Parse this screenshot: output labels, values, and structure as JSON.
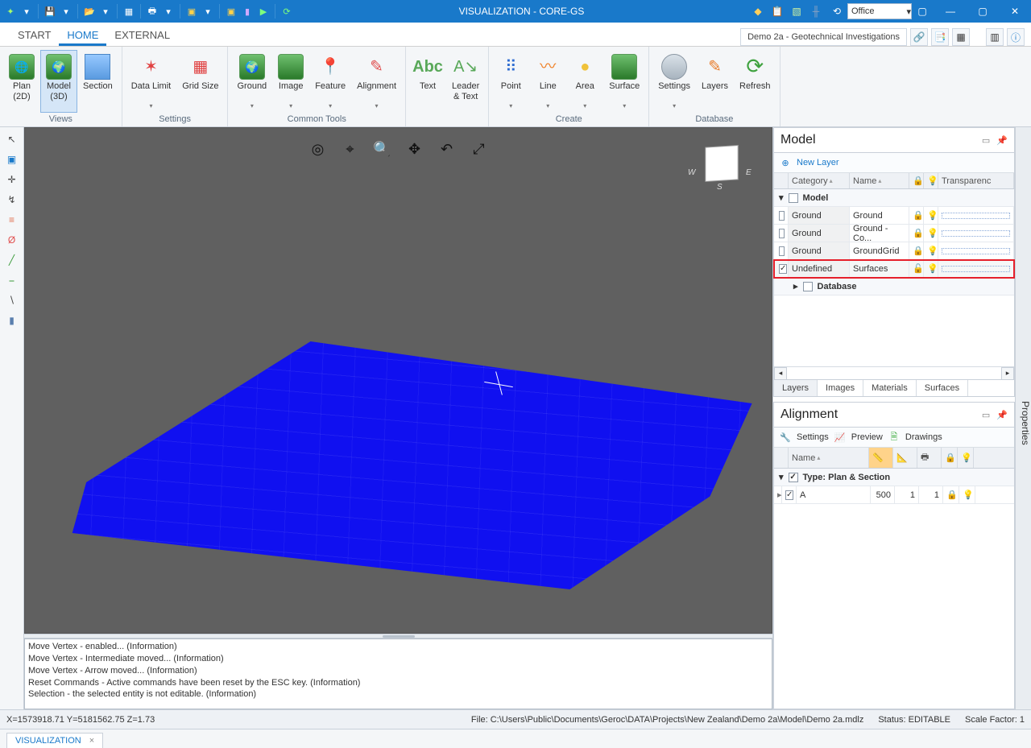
{
  "titlebar": {
    "title": "VISUALIZATION - CORE-GS",
    "office_dropdown": "Office"
  },
  "menubar": {
    "tabs": [
      "START",
      "HOME",
      "EXTERNAL"
    ],
    "active": 1,
    "project_name": "Demo 2a - Geotechnical Investigations"
  },
  "ribbon": {
    "groups": [
      {
        "label": "Views",
        "items": [
          {
            "t": "Plan",
            "t2": "(2D)"
          },
          {
            "t": "Model",
            "t2": "(3D)",
            "sel": true
          },
          {
            "t": "Section"
          }
        ]
      },
      {
        "label": "Settings",
        "items": [
          {
            "t": "Data Limit",
            "dd": true
          },
          {
            "t": "Grid Size"
          }
        ]
      },
      {
        "label": "Common Tools",
        "items": [
          {
            "t": "Ground",
            "dd": true
          },
          {
            "t": "Image",
            "dd": true
          },
          {
            "t": "Feature",
            "dd": true
          },
          {
            "t": "Alignment",
            "dd": true
          }
        ]
      },
      {
        "label": "",
        "items": [
          {
            "t": "Text"
          },
          {
            "t": "Leader",
            "t2": "& Text"
          }
        ]
      },
      {
        "label": "Create",
        "items": [
          {
            "t": "Point",
            "dd": true
          },
          {
            "t": "Line",
            "dd": true
          },
          {
            "t": "Area",
            "dd": true
          },
          {
            "t": "Surface",
            "dd": true
          }
        ]
      },
      {
        "label": "Database",
        "items": [
          {
            "t": "Settings",
            "dd": true
          },
          {
            "t": "Layers"
          },
          {
            "t": "Refresh"
          }
        ]
      }
    ]
  },
  "model_panel": {
    "title": "Model",
    "new_layer": "New Layer",
    "headers": {
      "category": "Category",
      "name": "Name",
      "transparency": "Transparenc"
    },
    "tree_root": "Model",
    "rows": [
      {
        "cat": "Ground",
        "name": "Ground",
        "checked": false
      },
      {
        "cat": "Ground",
        "name": "Ground - Co...",
        "checked": false
      },
      {
        "cat": "Ground",
        "name": "GroundGrid",
        "checked": false
      },
      {
        "cat": "Undefined",
        "name": "Surfaces",
        "checked": true,
        "hl": true
      }
    ],
    "db_node": "Database",
    "tabs": [
      "Layers",
      "Images",
      "Materials",
      "Surfaces"
    ]
  },
  "alignment_panel": {
    "title": "Alignment",
    "toolbar": {
      "settings": "Settings",
      "preview": "Preview",
      "drawings": "Drawings"
    },
    "header_name": "Name",
    "tree": "Type: Plan & Section",
    "row": {
      "name": "A",
      "v1": "500",
      "v2": "1",
      "v3": "1"
    }
  },
  "properties_tab": "Properties",
  "log_messages": [
    "Move Vertex - enabled... (Information)",
    "Move Vertex - Intermediate moved... (Information)",
    "Move Vertex - Arrow moved... (Information)",
    "Reset Commands - Active commands have been reset by the ESC key. (Information)",
    "Selection - the selected entity is not editable. (Information)"
  ],
  "status": {
    "coords": "X=1573918.71   Y=5181562.75   Z=1.73",
    "file": "File: C:\\Users\\Public\\Documents\\Geroc\\DATA\\Projects\\New Zealand\\Demo 2a\\Model\\Demo 2a.mdlz",
    "state": "Status: EDITABLE",
    "scale": "Scale Factor: 1"
  },
  "doc_tab": "VISUALIZATION"
}
